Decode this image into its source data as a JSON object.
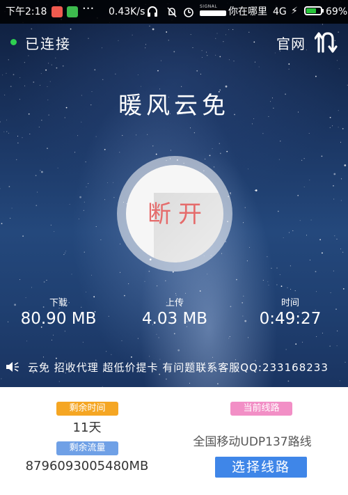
{
  "status_bar": {
    "time": "下午2:18",
    "net_speed": "0.43K/s",
    "signal_label": "SIGNAL",
    "carrier": "你在哪里",
    "network_type": "4G",
    "battery": "69%",
    "battery_level": 0.69
  },
  "header": {
    "connection_status": "已连接",
    "website_label": "官网",
    "app_name": "暖风云免"
  },
  "power_button": {
    "label": "断开"
  },
  "stats": {
    "download": {
      "label": "下载",
      "value": "80.90 MB"
    },
    "upload": {
      "label": "上传",
      "value": "4.03 MB"
    },
    "time": {
      "label": "时间",
      "value": "0:49:27"
    }
  },
  "announcement": {
    "text": "云免 招收代理 超低价提卡 有问题联系客服QQ:233168233"
  },
  "account": {
    "remaining_time_label": "剩余时间",
    "remaining_time": "11天",
    "remaining_data_label": "剩余流量",
    "remaining_data": "8796093005480MB"
  },
  "route": {
    "current_label": "当前线路",
    "current_value": "全国移动UDP137路线",
    "select_button": "选择线路"
  },
  "colors": {
    "connected_dot": "#2ed051",
    "disconnect_text": "#e56b6b",
    "badge_time": "#f5a623",
    "badge_data": "#6fa0e6",
    "badge_route": "#f28fc6",
    "select_button": "#3f86e8"
  }
}
